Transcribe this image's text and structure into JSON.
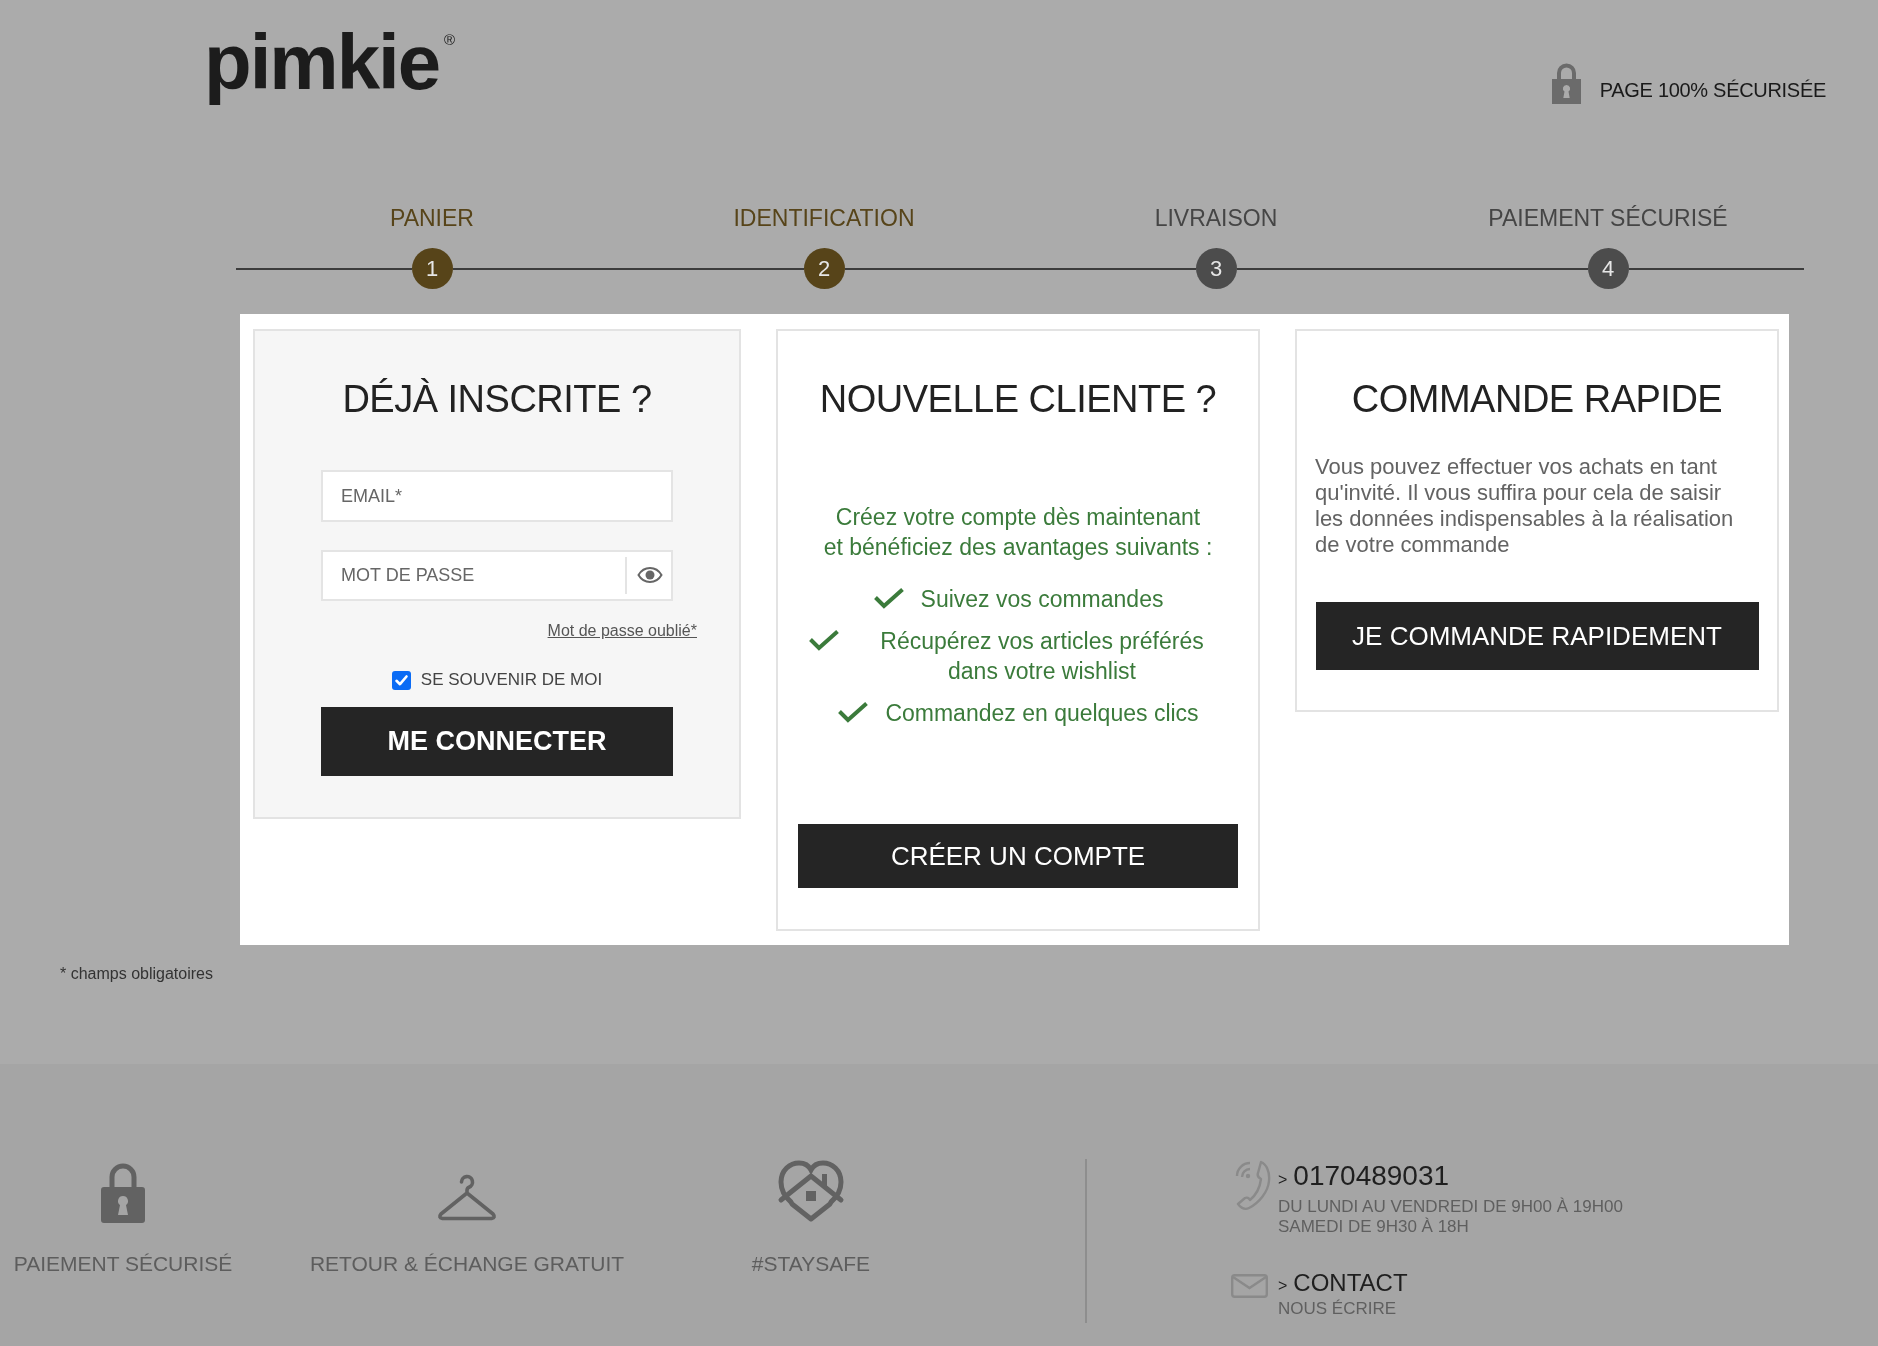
{
  "header": {
    "logo": "pimkie",
    "logo_mark": "®",
    "secure_label": "PAGE 100% SÉCURISÉE"
  },
  "steps": [
    {
      "number": "1",
      "label": "PANIER",
      "reached": true
    },
    {
      "number": "2",
      "label": "IDENTIFICATION",
      "reached": true
    },
    {
      "number": "3",
      "label": "LIVRAISON",
      "reached": false
    },
    {
      "number": "4",
      "label": "PAIEMENT SÉCURISÉ",
      "reached": false
    }
  ],
  "login": {
    "title": "DÉJÀ INSCRITE ?",
    "email": {
      "placeholder": "EMAIL*"
    },
    "password": {
      "placeholder": "MOT DE PASSE"
    },
    "forgot_link": "Mot de passe oublié*",
    "remember": {
      "label": "SE SOUVENIR DE MOI",
      "checked": true
    },
    "submit": "ME CONNECTER"
  },
  "signup": {
    "title": "NOUVELLE CLIENTE ?",
    "intro": "Créez votre compte dès maintenant\net bénéficiez des avantages suivants :",
    "benefits": [
      "Suivez vos commandes",
      "Récupérez vos articles préférés dans votre wishlist",
      "Commandez en quelques clics"
    ],
    "button": "CRÉER UN COMPTE"
  },
  "guest": {
    "title": "COMMANDE RAPIDE",
    "text": "Vous pouvez effectuer vos achats en tant qu'invité. Il vous suffira pour cela de saisir les données indispensables à la réalisation de votre commande",
    "button": "JE COMMANDE RAPIDEMENT"
  },
  "required_note": "* champs obligatoires",
  "footer": {
    "features": [
      {
        "kind": "lock",
        "label": "PAIEMENT SÉCURISÉ"
      },
      {
        "kind": "hanger",
        "label": "RETOUR & ÉCHANGE GRATUIT"
      },
      {
        "kind": "heart-home",
        "label": "#STAYSAFE"
      }
    ],
    "contacts": [
      {
        "kind": "phone",
        "marker": ">",
        "link": "0170489031",
        "details": [
          "DU LUNDI AU VENDREDI DE 9H00 À 19H00",
          "SAMEDI DE 9H30 À 18H"
        ]
      },
      {
        "kind": "mail",
        "marker": ">",
        "link": "CONTACT",
        "details": [
          "NOUS ÉCRIRE"
        ]
      }
    ]
  }
}
